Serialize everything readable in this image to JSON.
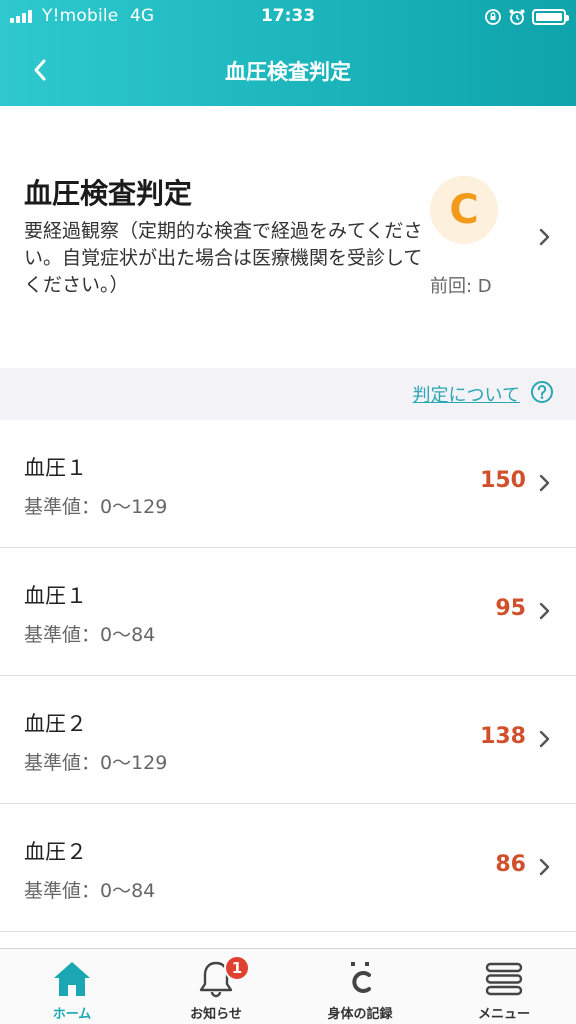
{
  "status_bar": {
    "carrier": "Y!mobile",
    "network": "4G",
    "time": "17:33"
  },
  "header": {
    "title": "血圧検査判定",
    "back_icon": "chevron-left-icon"
  },
  "summary": {
    "title": "血圧検査判定",
    "description": "要経過観察（定期的な検査で経過をみてください。自覚症状が出た場合は医療機関を受診してください。）",
    "grade": "C",
    "previous": "前回: D",
    "colors": {
      "grade_text": "#f39a1a",
      "grade_bg": "#fdf0dc"
    }
  },
  "info": {
    "link_label": "判定について",
    "help_icon": "question-circle-icon"
  },
  "results": [
    {
      "name": "血圧１",
      "range": "基準値：0〜129",
      "value": "150"
    },
    {
      "name": "血圧１",
      "range": "基準値：0〜84",
      "value": "95"
    },
    {
      "name": "血圧２",
      "range": "基準値：0〜129",
      "value": "138"
    },
    {
      "name": "血圧２",
      "range": "基準値：0〜84",
      "value": "86"
    }
  ],
  "tabs": [
    {
      "label": "ホーム",
      "icon": "home-icon",
      "active": true
    },
    {
      "label": "お知らせ",
      "icon": "bell-icon",
      "badge": "1"
    },
    {
      "label": "身体の記録",
      "icon": "c-logo-icon"
    },
    {
      "label": "メニュー",
      "icon": "menu-icon"
    }
  ],
  "colors": {
    "accent": "#1aa7b3",
    "value_alert": "#d0502b",
    "badge": "#e0402e"
  }
}
